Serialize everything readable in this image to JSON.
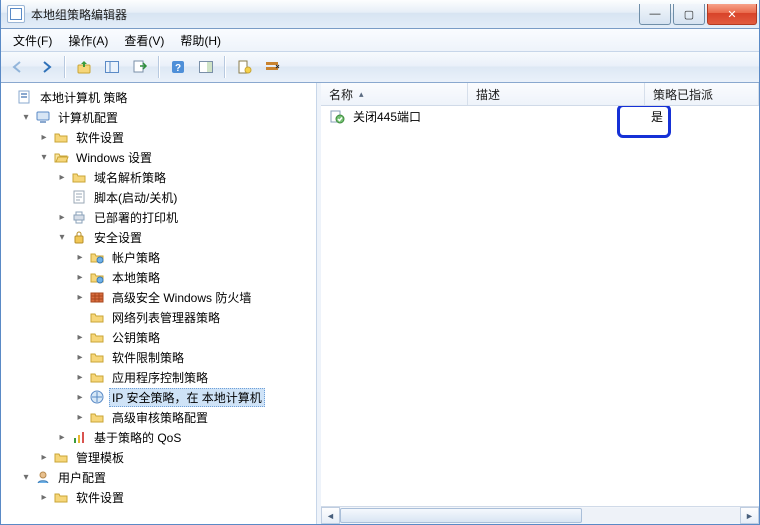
{
  "window": {
    "title": "本地组策略编辑器"
  },
  "win_buttons": {
    "min": "—",
    "max": "▢",
    "close": "✕"
  },
  "menu": {
    "file": "文件(F)",
    "action": "操作(A)",
    "view": "查看(V)",
    "help": "帮助(H)"
  },
  "tree": {
    "root": "本地计算机 策略",
    "computer_cfg": "计算机配置",
    "software_settings": "软件设置",
    "windows_settings": "Windows 设置",
    "name_res_policy": "域名解析策略",
    "scripts": "脚本(启动/关机)",
    "deployed_printers": "已部署的打印机",
    "security_settings": "安全设置",
    "account_policies": "帐户策略",
    "local_policies": "本地策略",
    "adv_firewall": "高级安全 Windows 防火墙",
    "nlm_policies": "网络列表管理器策略",
    "pubkey_policies": "公钥策略",
    "sw_restrict": "软件限制策略",
    "appctrl": "应用程序控制策略",
    "ipsec": "IP 安全策略，在 本地计算机",
    "adv_audit": "高级审核策略配置",
    "qos": "基于策略的 QoS",
    "admin_templates": "管理模板",
    "user_cfg": "用户配置",
    "software_settings2": "软件设置"
  },
  "columns": {
    "name": "名称",
    "desc": "描述",
    "assigned": "策略已指派"
  },
  "list": {
    "items": [
      {
        "name": "关闭445端口",
        "desc": "",
        "assigned": "是"
      }
    ]
  }
}
